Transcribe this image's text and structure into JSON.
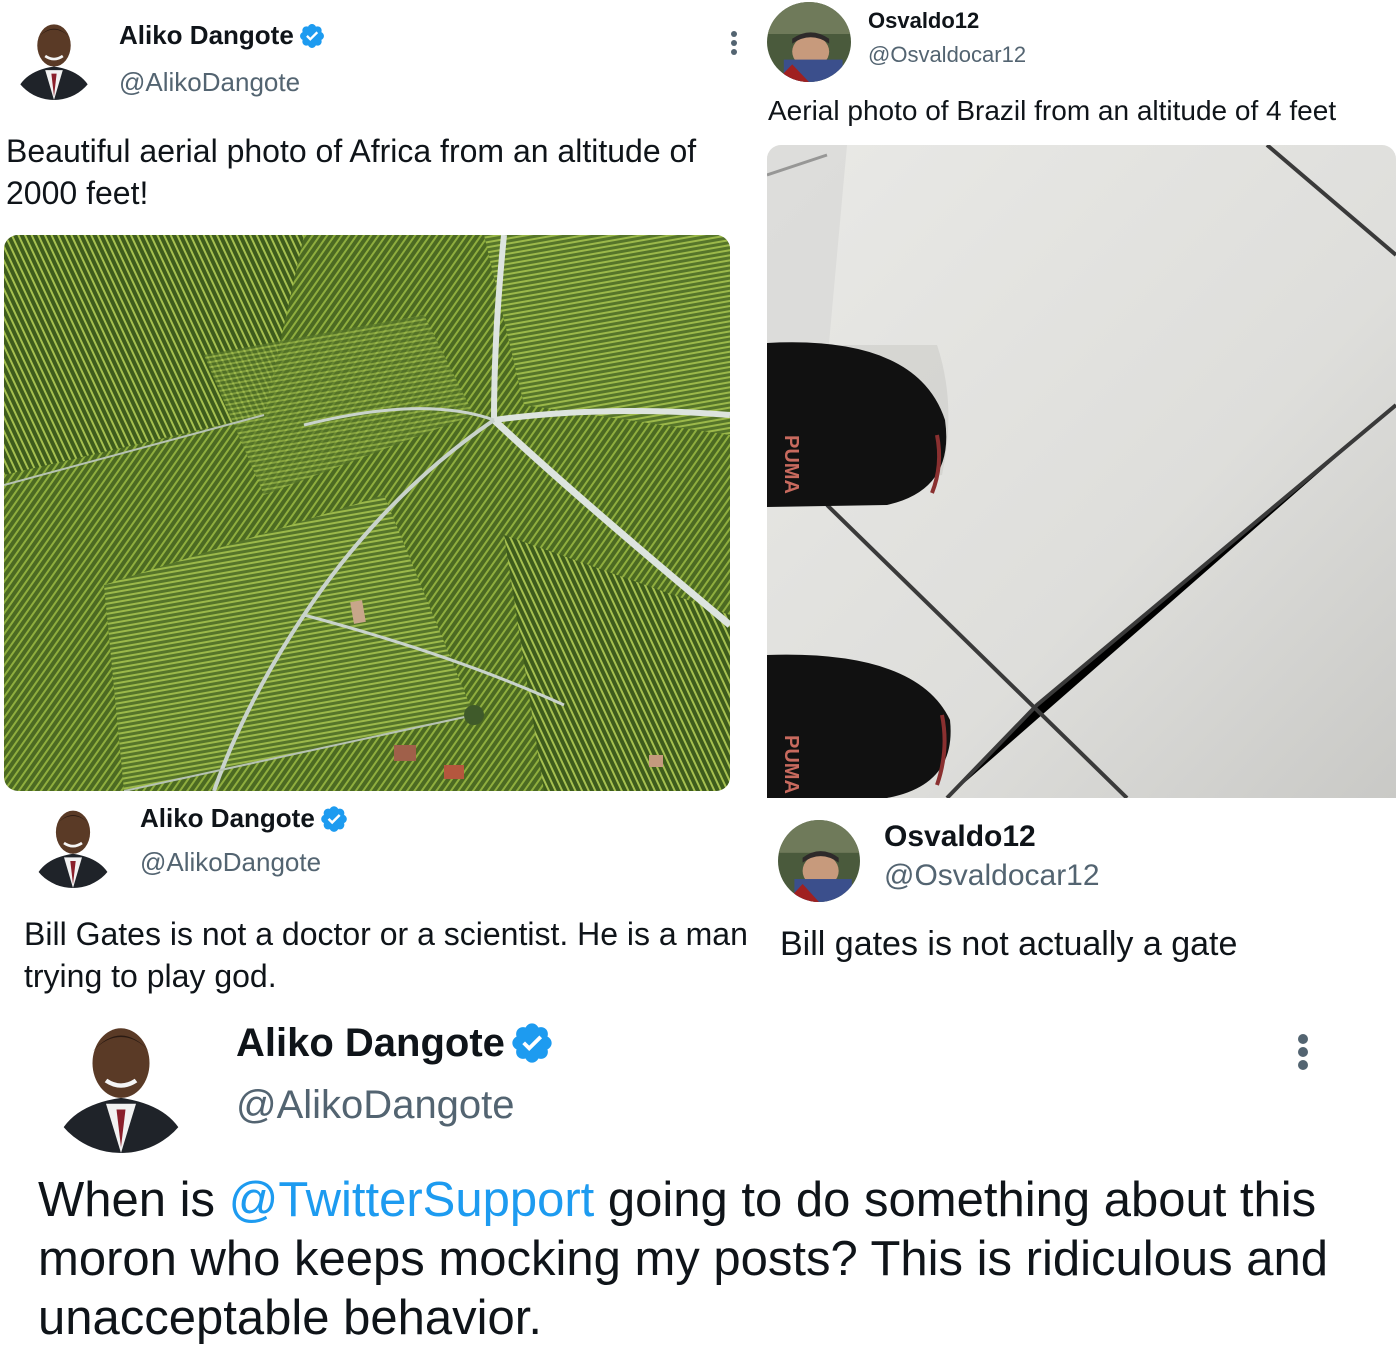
{
  "tweets": {
    "t1": {
      "name": "Aliko Dangote",
      "handle": "@AlikoDangote",
      "text": "Beautiful aerial photo of Africa from an altitude of 2000 feet!"
    },
    "t2": {
      "name": "Osvaldo12",
      "handle": "@Osvaldocar12",
      "text": "Aerial photo of Brazil from an altitude of 4 feet",
      "shoe_brand": "PUMA"
    },
    "t3": {
      "name": "Aliko Dangote",
      "handle": "@AlikoDangote",
      "text": "Bill Gates is not a doctor or a scientist. He is a man trying to play god."
    },
    "t4": {
      "name": "Osvaldo12",
      "handle": "@Osvaldocar12",
      "text": "Bill gates is not actually a gate"
    },
    "t5": {
      "name": "Aliko Dangote",
      "handle": "@AlikoDangote",
      "text_before": "When is ",
      "mention": "@TwitterSupport",
      "text_after": " going to do something about this moron who keeps mocking my posts? This is ridiculous and unacceptable behavior."
    }
  },
  "icons": {
    "verified": "verified-badge-icon",
    "more": "more-options-icon"
  },
  "colors": {
    "accent": "#1d9bf0",
    "muted": "#536471",
    "text": "#0f1419"
  }
}
